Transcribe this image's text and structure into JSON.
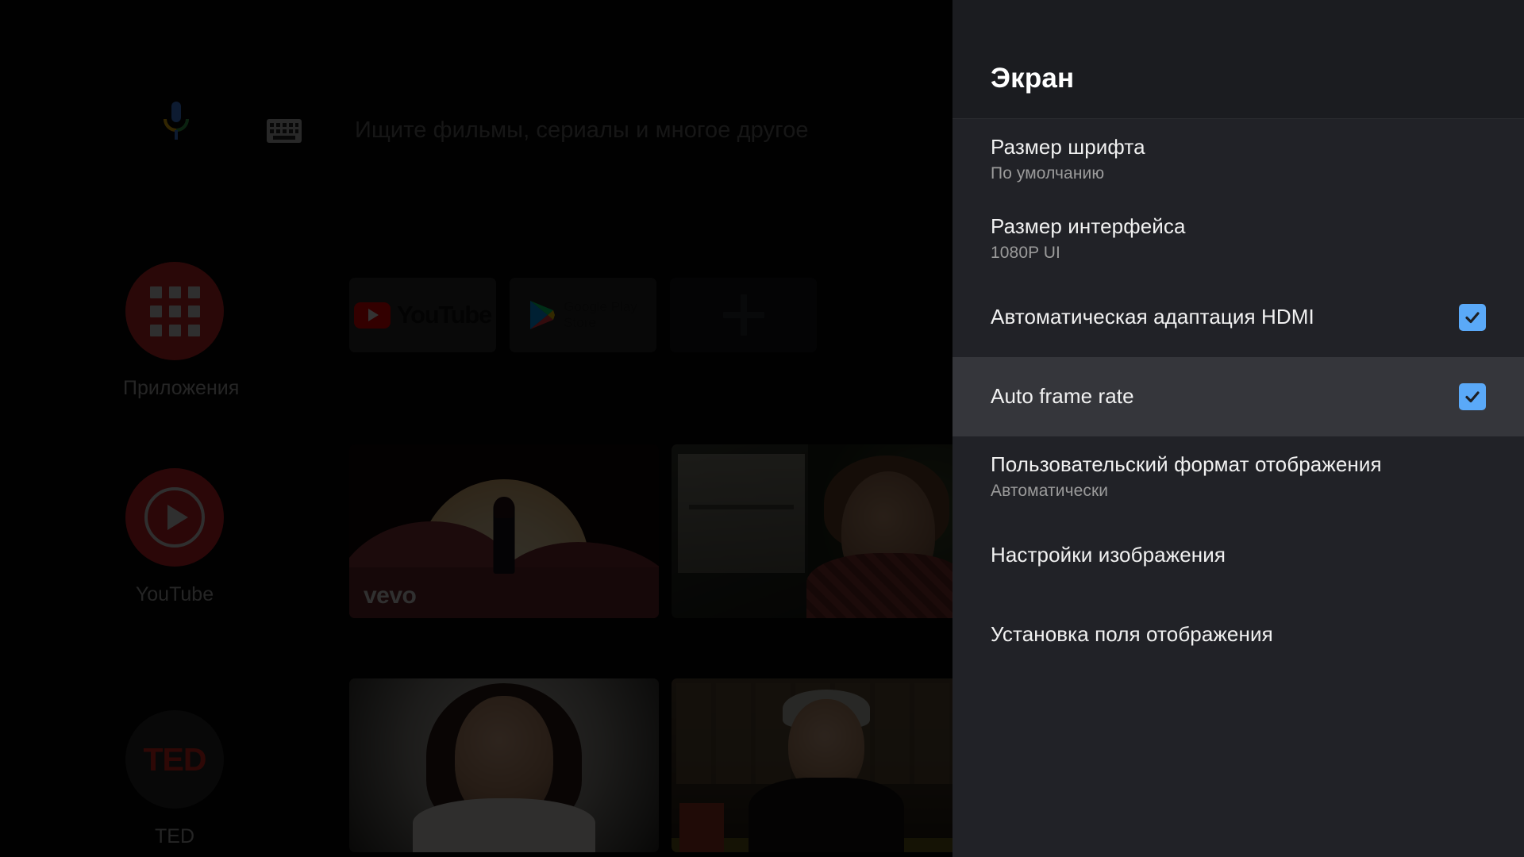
{
  "launcher": {
    "search": {
      "placeholder": "Ищите фильмы, сериалы и многое другое",
      "mic_icon": "google-assistant-mic-icon",
      "keyboard_icon": "keyboard-icon"
    },
    "rail": [
      {
        "label": "Приложения",
        "icon": "apps-grid-icon",
        "color": "#cf2b2b"
      },
      {
        "label": "YouTube",
        "icon": "play-circle-icon",
        "color": "#d5232a"
      },
      {
        "label": "TED",
        "icon": "ted-logo-icon",
        "color": "#2a2a2a"
      }
    ],
    "app_cards": [
      {
        "label": "YouTube",
        "icon": "youtube-logo-icon"
      },
      {
        "label": "Google Play Store",
        "icon": "google-play-logo-icon",
        "line1": "Google Play",
        "line2": "Store"
      },
      {
        "label": "",
        "icon": "plus-icon"
      }
    ],
    "thumbnails": [
      {
        "name": "vevo-music-video-thumbnail",
        "watermark": "vevo"
      },
      {
        "name": "movie-thumbnail",
        "watermark": ""
      },
      {
        "name": "ted-talk-thumbnail-1",
        "watermark": ""
      },
      {
        "name": "ted-talk-thumbnail-2",
        "watermark": ""
      }
    ]
  },
  "panel": {
    "title": "Экран",
    "accent_color": "#5aa9f8",
    "background_color": "#212227",
    "focused_background_color": "#35363b",
    "items": [
      {
        "title": "Размер шрифта",
        "subtitle": "По умолчанию",
        "type": "value",
        "focused": false,
        "checked": null
      },
      {
        "title": "Размер интерфейса",
        "subtitle": "1080P UI",
        "type": "value",
        "focused": false,
        "checked": null
      },
      {
        "title": "Автоматическая адаптация HDMI",
        "subtitle": "",
        "type": "checkbox",
        "focused": false,
        "checked": true
      },
      {
        "title": "Auto frame rate",
        "subtitle": "",
        "type": "checkbox",
        "focused": true,
        "checked": true
      },
      {
        "title": "Пользовательский формат отображения",
        "subtitle": "Автоматически",
        "type": "value",
        "focused": false,
        "checked": null
      },
      {
        "title": "Настройки изображения",
        "subtitle": "",
        "type": "link",
        "focused": false,
        "checked": null
      },
      {
        "title": "Установка поля отображения",
        "subtitle": "",
        "type": "link",
        "focused": false,
        "checked": null
      }
    ]
  }
}
